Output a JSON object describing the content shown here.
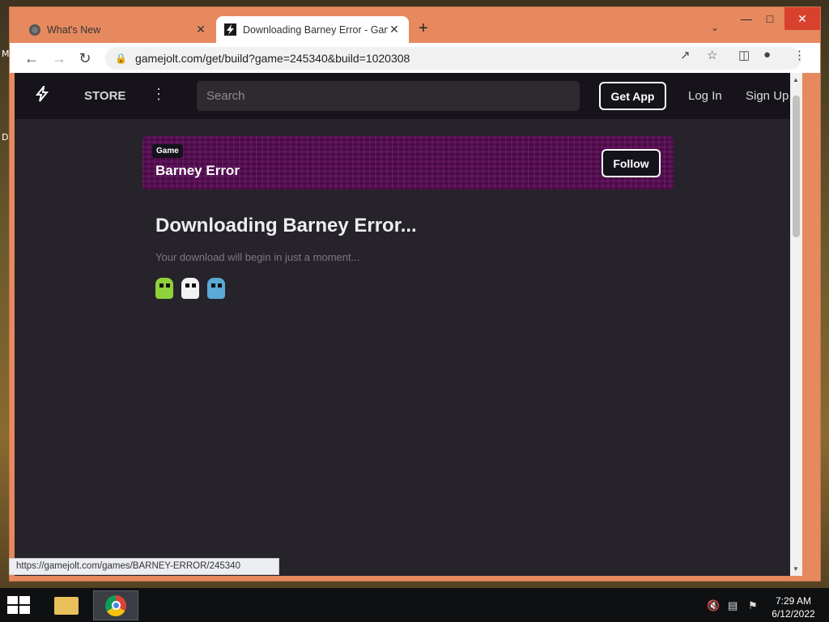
{
  "browser": {
    "tabs": [
      {
        "title": "What's New",
        "close": "✕"
      },
      {
        "title": "Downloading Barney Error - Game Jolt",
        "close": "✕"
      }
    ],
    "new_tab": "+",
    "address": {
      "url": "gamejolt.com/get/build?game=245340&build=1020308"
    },
    "status_url": "https://gamejolt.com/games/BARNEY-ERROR/245340"
  },
  "site": {
    "nav": {
      "store": "STORE",
      "search_placeholder": "Search",
      "get_app": "Get App",
      "log_in": "Log In",
      "sign_up": "Sign Up"
    },
    "banner": {
      "tag": "Game",
      "game_name": "Barney Error",
      "follow": "Follow"
    },
    "download": {
      "title": "Downloading Barney Error...",
      "subtitle": "Your download will begin in just a moment..."
    }
  },
  "taskbar": {
    "time": "7:29 AM",
    "date": "6/12/2022"
  },
  "colors": {
    "window_frame": "#e6895f",
    "page_bg": "#27232b",
    "nav_bg": "#16141a",
    "banner_purple": "#4a0a46",
    "sprite_green": "#8fd13a",
    "sprite_white": "#f2f2f2",
    "sprite_blue": "#5aa9d6"
  }
}
